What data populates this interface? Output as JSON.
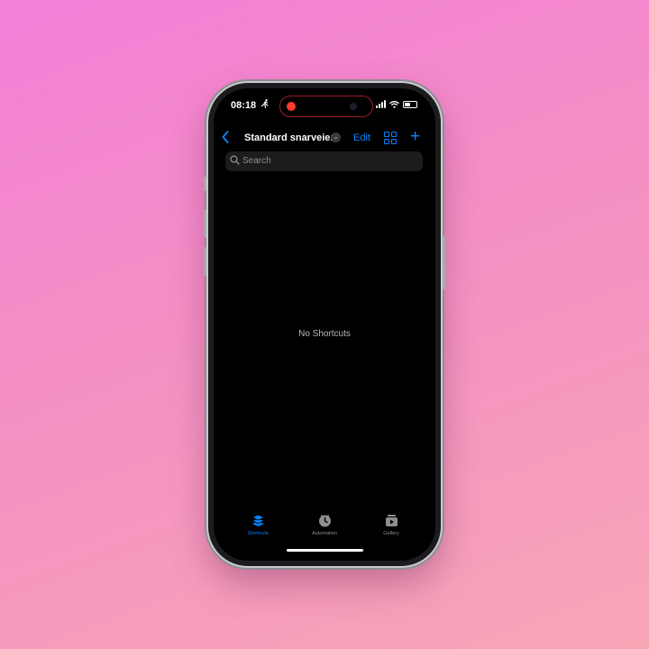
{
  "status_bar": {
    "time": "08:18"
  },
  "nav": {
    "title": "Standard snarveier",
    "edit_label": "Edit"
  },
  "search": {
    "placeholder": "Search"
  },
  "empty_state": {
    "message": "No Shortcuts"
  },
  "tabs": [
    {
      "label": "Shortcuts",
      "icon": "layers-icon",
      "active": true
    },
    {
      "label": "Automation",
      "icon": "clock-icon",
      "active": false
    },
    {
      "label": "Gallery",
      "icon": "gallery-icon",
      "active": false
    }
  ],
  "colors": {
    "accent": "#0a84ff",
    "inactive": "#8e8e93",
    "recording": "#ff3b30"
  }
}
